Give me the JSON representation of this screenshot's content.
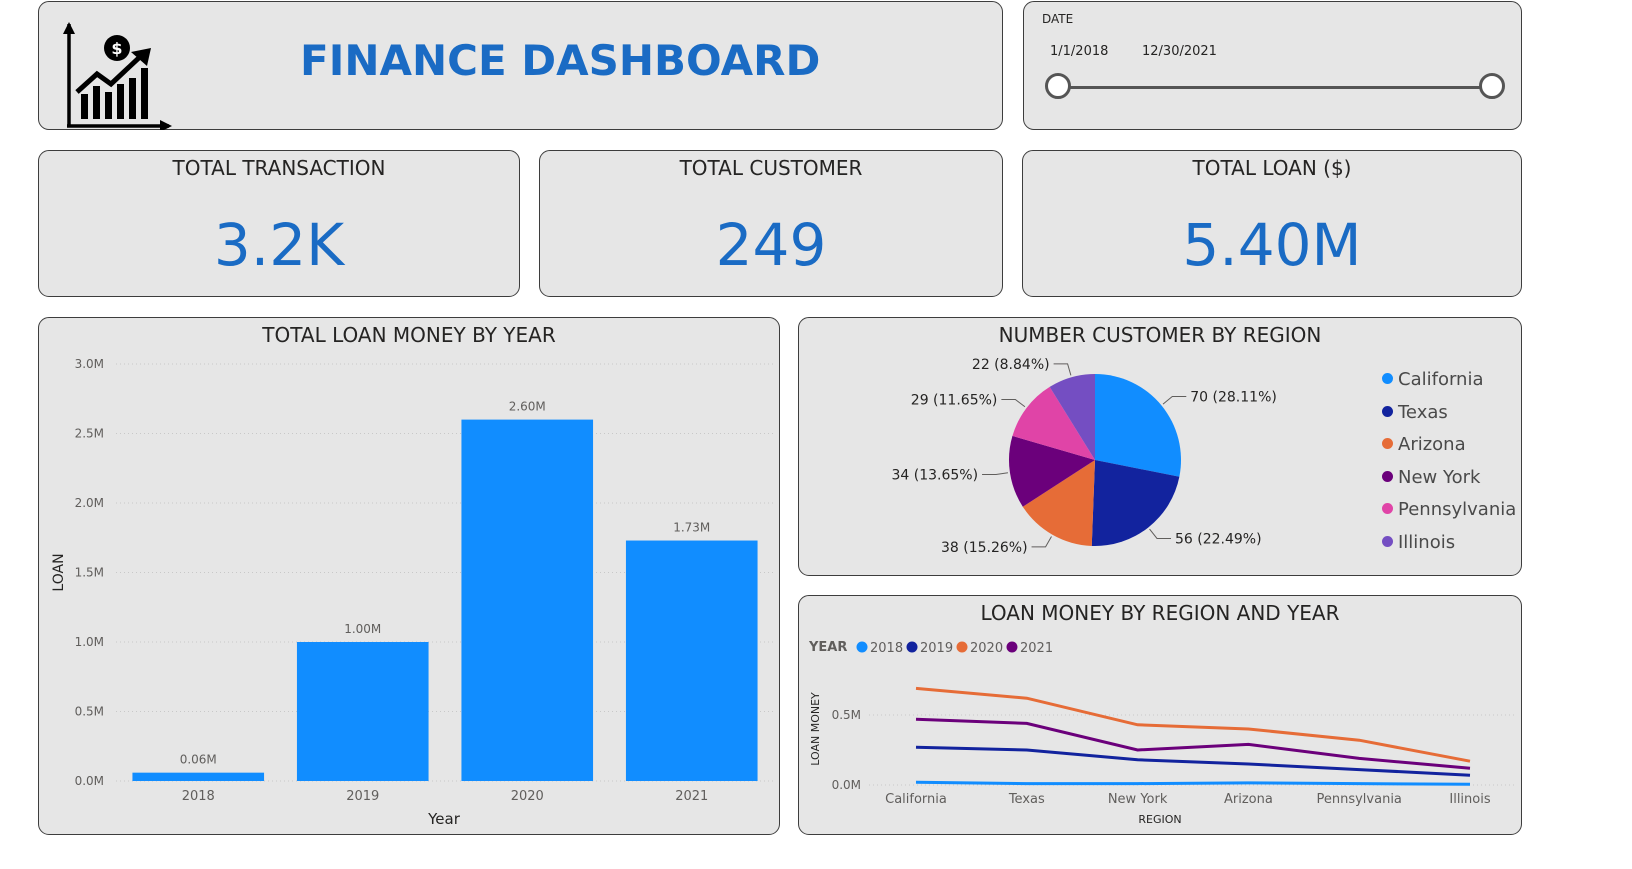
{
  "header": {
    "title": "FINANCE DASHBOARD",
    "logo_icon": "finance-growth-icon"
  },
  "date_slicer": {
    "label": "DATE",
    "start": "1/1/2018",
    "end": "12/30/2021"
  },
  "kpis": [
    {
      "label": "TOTAL TRANSACTION",
      "value": "3.2K"
    },
    {
      "label": "TOTAL CUSTOMER",
      "value": "249"
    },
    {
      "label": "TOTAL LOAN ($)",
      "value": "5.40M"
    }
  ],
  "colors": {
    "accent": "#1a6bc4",
    "bar": "#118dff",
    "card_bg": "#e6e6e6",
    "card_border": "#3d3d3d"
  },
  "bar_chart": {
    "title": "TOTAL LOAN MONEY BY YEAR",
    "chart_data": {
      "type": "bar",
      "categories": [
        "2018",
        "2019",
        "2020",
        "2021"
      ],
      "values": [
        0.06,
        1.0,
        2.6,
        1.73
      ],
      "value_labels": [
        "0.06M",
        "1.00M",
        "2.60M",
        "1.73M"
      ],
      "xlabel": "Year",
      "ylabel": "LOAN",
      "ylim": [
        0,
        3.0
      ],
      "yticks": [
        0,
        0.5,
        1.0,
        1.5,
        2.0,
        2.5,
        3.0
      ],
      "ytick_labels": [
        "0.0M",
        "0.5M",
        "1.0M",
        "1.5M",
        "2.0M",
        "2.5M",
        "3.0M"
      ],
      "grid": true,
      "color": "#118dff"
    }
  },
  "pie_chart": {
    "title": "NUMBER CUSTOMER BY REGION",
    "chart_data": {
      "type": "pie",
      "categories": [
        "California",
        "Texas",
        "Arizona",
        "New York",
        "Pennsylvania",
        "Illinois"
      ],
      "values": [
        70,
        56,
        38,
        34,
        29,
        22
      ],
      "labels": [
        "70 (28.11%)",
        "56 (22.49%)",
        "38 (15.26%)",
        "34 (13.65%)",
        "29 (11.65%)",
        "22 (8.84%)"
      ],
      "colors": [
        "#118dff",
        "#12239e",
        "#e66c37",
        "#6b007b",
        "#e044a7",
        "#744ec2"
      ],
      "legend_position": "right"
    }
  },
  "line_chart": {
    "title": "LOAN MONEY BY REGION AND YEAR",
    "legend_title": "YEAR",
    "chart_data": {
      "type": "line",
      "categories": [
        "California",
        "Texas",
        "New York",
        "Arizona",
        "Pennsylvania",
        "Illinois"
      ],
      "xlabel": "REGION",
      "ylabel": "LOAN MONEY",
      "ylim": [
        0,
        0.75
      ],
      "yticks": [
        0,
        0.5
      ],
      "ytick_labels": [
        "0.0M",
        "0.5M"
      ],
      "grid": true,
      "legend_position": "top-left",
      "series": [
        {
          "name": "2018",
          "color": "#118dff",
          "values": [
            0.02,
            0.01,
            0.01,
            0.015,
            0.01,
            0.005
          ]
        },
        {
          "name": "2019",
          "color": "#12239e",
          "values": [
            0.27,
            0.25,
            0.18,
            0.15,
            0.11,
            0.07
          ]
        },
        {
          "name": "2020",
          "color": "#e66c37",
          "values": [
            0.69,
            0.62,
            0.43,
            0.4,
            0.32,
            0.17
          ]
        },
        {
          "name": "2021",
          "color": "#6b007b",
          "values": [
            0.47,
            0.44,
            0.25,
            0.29,
            0.19,
            0.12
          ]
        }
      ]
    }
  }
}
